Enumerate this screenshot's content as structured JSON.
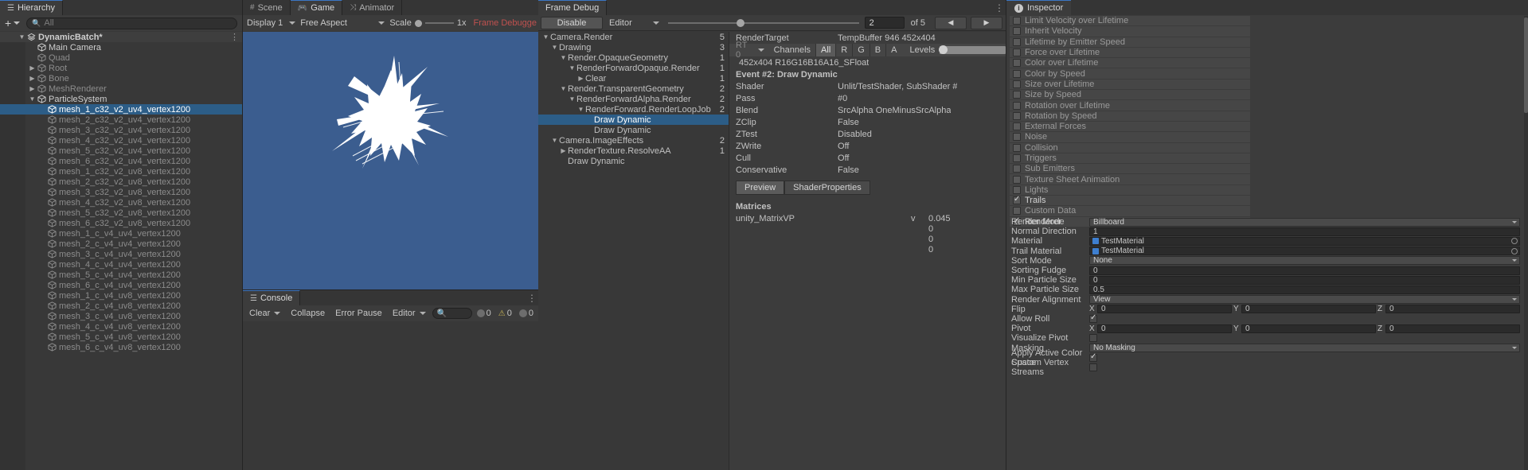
{
  "hierarchy": {
    "tab_label": "Hierarchy",
    "tab_icon": "hierarchy-icon",
    "add_label": "+",
    "search_placeholder": "All",
    "items": [
      {
        "label": "DynamicBatch*",
        "indent": 0,
        "twisty": "▼",
        "icon": "scene-icon",
        "style": "header"
      },
      {
        "label": "Main Camera",
        "indent": 1,
        "twisty": "",
        "icon": "cube-icon",
        "style": "bright"
      },
      {
        "label": "Quad",
        "indent": 1,
        "twisty": "",
        "icon": "cube-icon",
        "style": "dim"
      },
      {
        "label": "Root",
        "indent": 1,
        "twisty": "▶",
        "icon": "cube-icon",
        "style": "dim"
      },
      {
        "label": "Bone",
        "indent": 1,
        "twisty": "▶",
        "icon": "cube-icon",
        "style": "dim"
      },
      {
        "label": "MeshRenderer",
        "indent": 1,
        "twisty": "▶",
        "icon": "cube-icon",
        "style": "dim"
      },
      {
        "label": "ParticleSystem",
        "indent": 1,
        "twisty": "▼",
        "icon": "cube-icon",
        "style": "bright"
      },
      {
        "label": "mesh_1_c32_v2_uv4_vertex1200",
        "indent": 2,
        "twisty": "",
        "icon": "cube-icon",
        "style": "sel"
      },
      {
        "label": "mesh_2_c32_v2_uv4_vertex1200",
        "indent": 2,
        "twisty": "",
        "icon": "cube-icon",
        "style": "dim"
      },
      {
        "label": "mesh_3_c32_v2_uv4_vertex1200",
        "indent": 2,
        "twisty": "",
        "icon": "cube-icon",
        "style": "dim"
      },
      {
        "label": "mesh_4_c32_v2_uv4_vertex1200",
        "indent": 2,
        "twisty": "",
        "icon": "cube-icon",
        "style": "dim"
      },
      {
        "label": "mesh_5_c32_v2_uv4_vertex1200",
        "indent": 2,
        "twisty": "",
        "icon": "cube-icon",
        "style": "dim"
      },
      {
        "label": "mesh_6_c32_v2_uv4_vertex1200",
        "indent": 2,
        "twisty": "",
        "icon": "cube-icon",
        "style": "dim"
      },
      {
        "label": "mesh_1_c32_v2_uv8_vertex1200",
        "indent": 2,
        "twisty": "",
        "icon": "cube-icon",
        "style": "dim"
      },
      {
        "label": "mesh_2_c32_v2_uv8_vertex1200",
        "indent": 2,
        "twisty": "",
        "icon": "cube-icon",
        "style": "dim"
      },
      {
        "label": "mesh_3_c32_v2_uv8_vertex1200",
        "indent": 2,
        "twisty": "",
        "icon": "cube-icon",
        "style": "dim"
      },
      {
        "label": "mesh_4_c32_v2_uv8_vertex1200",
        "indent": 2,
        "twisty": "",
        "icon": "cube-icon",
        "style": "dim"
      },
      {
        "label": "mesh_5_c32_v2_uv8_vertex1200",
        "indent": 2,
        "twisty": "",
        "icon": "cube-icon",
        "style": "dim"
      },
      {
        "label": "mesh_6_c32_v2_uv8_vertex1200",
        "indent": 2,
        "twisty": "",
        "icon": "cube-icon",
        "style": "dim"
      },
      {
        "label": "mesh_1_c_v4_uv4_vertex1200",
        "indent": 2,
        "twisty": "",
        "icon": "cube-icon",
        "style": "dim"
      },
      {
        "label": "mesh_2_c_v4_uv4_vertex1200",
        "indent": 2,
        "twisty": "",
        "icon": "cube-icon",
        "style": "dim"
      },
      {
        "label": "mesh_3_c_v4_uv4_vertex1200",
        "indent": 2,
        "twisty": "",
        "icon": "cube-icon",
        "style": "dim"
      },
      {
        "label": "mesh_4_c_v4_uv4_vertex1200",
        "indent": 2,
        "twisty": "",
        "icon": "cube-icon",
        "style": "dim"
      },
      {
        "label": "mesh_5_c_v4_uv4_vertex1200",
        "indent": 2,
        "twisty": "",
        "icon": "cube-icon",
        "style": "dim"
      },
      {
        "label": "mesh_6_c_v4_uv4_vertex1200",
        "indent": 2,
        "twisty": "",
        "icon": "cube-icon",
        "style": "dim"
      },
      {
        "label": "mesh_1_c_v4_uv8_vertex1200",
        "indent": 2,
        "twisty": "",
        "icon": "cube-icon",
        "style": "dim"
      },
      {
        "label": "mesh_2_c_v4_uv8_vertex1200",
        "indent": 2,
        "twisty": "",
        "icon": "cube-icon",
        "style": "dim"
      },
      {
        "label": "mesh_3_c_v4_uv8_vertex1200",
        "indent": 2,
        "twisty": "",
        "icon": "cube-icon",
        "style": "dim"
      },
      {
        "label": "mesh_4_c_v4_uv8_vertex1200",
        "indent": 2,
        "twisty": "",
        "icon": "cube-icon",
        "style": "dim"
      },
      {
        "label": "mesh_5_c_v4_uv8_vertex1200",
        "indent": 2,
        "twisty": "",
        "icon": "cube-icon",
        "style": "dim"
      },
      {
        "label": "mesh_6_c_v4_uv8_vertex1200",
        "indent": 2,
        "twisty": "",
        "icon": "cube-icon",
        "style": "dim"
      }
    ]
  },
  "gameview": {
    "tabs": [
      {
        "label": "Scene",
        "icon": "grid-icon",
        "active": false
      },
      {
        "label": "Game",
        "icon": "gamepad-icon",
        "active": true
      },
      {
        "label": "Animator",
        "icon": "animator-icon",
        "active": false
      }
    ],
    "display": "Display 1",
    "aspect": "Free Aspect",
    "scale_label": "Scale",
    "scale_value": "1x",
    "warning": "Frame Debugge"
  },
  "console": {
    "tab_label": "Console",
    "clear_label": "Clear",
    "collapse_label": "Collapse",
    "error_pause_label": "Error Pause",
    "editor_label": "Editor",
    "search_placeholder": "",
    "counts": {
      "info": "0",
      "warning": "0",
      "error": "0"
    }
  },
  "framedebug": {
    "tab_label": "Frame Debug",
    "disable_label": "Disable",
    "target_label": "Editor",
    "current_event": "2",
    "event_total": "of 5",
    "prev_icon": "arrow-left-icon",
    "next_icon": "arrow-right-icon",
    "tree": [
      {
        "label": "Camera.Render",
        "indent": 0,
        "twisty": "▼",
        "count": "5",
        "sel": false
      },
      {
        "label": "Drawing",
        "indent": 1,
        "twisty": "▼",
        "count": "3",
        "sel": false
      },
      {
        "label": "Render.OpaqueGeometry",
        "indent": 2,
        "twisty": "▼",
        "count": "1",
        "sel": false
      },
      {
        "label": "RenderForwardOpaque.Render",
        "indent": 3,
        "twisty": "▼",
        "count": "1",
        "sel": false
      },
      {
        "label": "Clear",
        "indent": 4,
        "twisty": "▶",
        "count": "1",
        "sel": false
      },
      {
        "label": "Render.TransparentGeometry",
        "indent": 2,
        "twisty": "▼",
        "count": "2",
        "sel": false
      },
      {
        "label": "RenderForwardAlpha.Render",
        "indent": 3,
        "twisty": "▼",
        "count": "2",
        "sel": false
      },
      {
        "label": "RenderForward.RenderLoopJob",
        "indent": 4,
        "twisty": "▼",
        "count": "2",
        "sel": false
      },
      {
        "label": "Draw Dynamic",
        "indent": 5,
        "twisty": "",
        "count": "",
        "sel": true
      },
      {
        "label": "Draw Dynamic",
        "indent": 5,
        "twisty": "",
        "count": "",
        "sel": false
      },
      {
        "label": "Camera.ImageEffects",
        "indent": 1,
        "twisty": "▼",
        "count": "2",
        "sel": false
      },
      {
        "label": "RenderTexture.ResolveAA",
        "indent": 2,
        "twisty": "▶",
        "count": "1",
        "sel": false
      },
      {
        "label": "Draw Dynamic",
        "indent": 2,
        "twisty": "",
        "count": "",
        "sel": false
      }
    ],
    "detail": {
      "rendertarget_label": "RenderTarget",
      "rendertarget_value": "TempBuffer 946 452x404",
      "rt_label": "RT 0",
      "channels_label": "Channels",
      "channel_options": [
        "All",
        "R",
        "G",
        "B",
        "A"
      ],
      "channel_selected": "All",
      "levels_label": "Levels",
      "format": "452x404 R16G16B16A16_SFloat",
      "event_title": "Event #2: Draw Dynamic",
      "rows": [
        {
          "k": "Shader",
          "v": "Unlit/TestShader, SubShader #"
        },
        {
          "k": "Pass",
          "v": "#0"
        },
        {
          "k": "Blend",
          "v": "SrcAlpha OneMinusSrcAlpha"
        },
        {
          "k": "ZClip",
          "v": "False"
        },
        {
          "k": "ZTest",
          "v": "Disabled"
        },
        {
          "k": "ZWrite",
          "v": "Off"
        },
        {
          "k": "Cull",
          "v": "Off"
        },
        {
          "k": "Conservative",
          "v": "False"
        }
      ],
      "preview_tab": "Preview",
      "shaderprops_tab": "ShaderProperties",
      "matrices_label": "Matrices",
      "matrix_name": "unity_MatrixVP",
      "matrix_kind": "v",
      "matrix_values": [
        "0.045",
        "0",
        "0",
        "0"
      ]
    }
  },
  "inspector": {
    "tab_label": "Inspector",
    "modules": [
      {
        "label": "Limit Velocity over Lifetime",
        "checked": false
      },
      {
        "label": "Inherit Velocity",
        "checked": false
      },
      {
        "label": "Lifetime by Emitter Speed",
        "checked": false
      },
      {
        "label": "Force over Lifetime",
        "checked": false
      },
      {
        "label": "Color over Lifetime",
        "checked": false
      },
      {
        "label": "Color by Speed",
        "checked": false
      },
      {
        "label": "Size over Lifetime",
        "checked": false
      },
      {
        "label": "Size by Speed",
        "checked": false
      },
      {
        "label": "Rotation over Lifetime",
        "checked": false
      },
      {
        "label": "Rotation by Speed",
        "checked": false
      },
      {
        "label": "External Forces",
        "checked": false
      },
      {
        "label": "Noise",
        "checked": false
      },
      {
        "label": "Collision",
        "checked": false
      },
      {
        "label": "Triggers",
        "checked": false
      },
      {
        "label": "Sub Emitters",
        "checked": false
      },
      {
        "label": "Texture Sheet Animation",
        "checked": false
      },
      {
        "label": "Lights",
        "checked": false
      },
      {
        "label": "Trails",
        "checked": true
      },
      {
        "label": "Custom Data",
        "checked": false
      },
      {
        "label": "Renderer",
        "checked": true
      }
    ],
    "properties": [
      {
        "label": "Render Mode",
        "type": "popup",
        "value": "Billboard"
      },
      {
        "label": "Normal Direction",
        "type": "field",
        "value": "1"
      },
      {
        "label": "Material",
        "type": "object",
        "value": "TestMaterial"
      },
      {
        "label": "Trail Material",
        "type": "object",
        "value": "TestMaterial"
      },
      {
        "label": "Sort Mode",
        "type": "popup",
        "value": "None"
      },
      {
        "label": "Sorting Fudge",
        "type": "field",
        "value": "0"
      },
      {
        "label": "Min Particle Size",
        "type": "field",
        "value": "0"
      },
      {
        "label": "Max Particle Size",
        "type": "field",
        "value": "0.5"
      },
      {
        "label": "Render Alignment",
        "type": "popup",
        "value": "View"
      },
      {
        "label": "Flip",
        "type": "vector3",
        "value": [
          "0",
          "0",
          "0"
        ],
        "axes": [
          "X",
          "Y",
          "Z"
        ]
      },
      {
        "label": "Allow Roll",
        "type": "checkbox",
        "value": true
      },
      {
        "label": "Pivot",
        "type": "vector3",
        "value": [
          "0",
          "0",
          "0"
        ],
        "axes": [
          "X",
          "Y",
          "Z"
        ]
      },
      {
        "label": "Visualize Pivot",
        "type": "checkbox",
        "value": false
      },
      {
        "label": "Masking",
        "type": "popup",
        "value": "No Masking"
      },
      {
        "label": "Apply Active Color Space",
        "type": "checkbox",
        "value": true
      },
      {
        "label": "Custom Vertex Streams",
        "type": "checkbox",
        "value": false
      }
    ]
  },
  "colors": {
    "selection_blue": "#2c5d87",
    "game_background": "#3b5d8f",
    "warning_red": "#c0514f",
    "accent_tab": "#3b76c4"
  }
}
